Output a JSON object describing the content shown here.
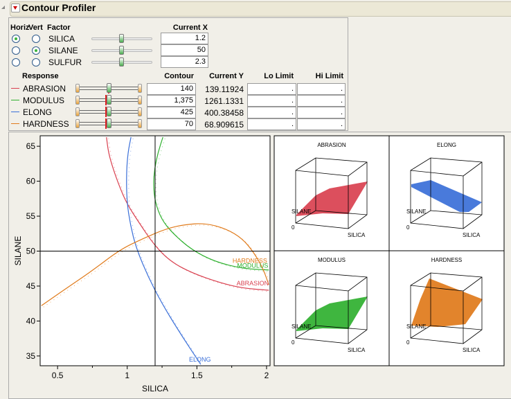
{
  "title": "Contour Profiler",
  "factors": {
    "headers": {
      "horiz": "Horiz",
      "vert": "Vert",
      "factor": "Factor",
      "current_x": "Current X"
    },
    "items": [
      {
        "name": "SILICA",
        "value": "1.2",
        "horiz": true,
        "vert": false,
        "slider": 0.5
      },
      {
        "name": "SILANE",
        "value": "50",
        "horiz": false,
        "vert": true,
        "slider": 0.5
      },
      {
        "name": "SULFUR",
        "value": "2.3",
        "horiz": false,
        "vert": false,
        "slider": 0.5
      }
    ]
  },
  "responses": {
    "headers": {
      "response": "Response",
      "contour": "Contour",
      "current_y": "Current Y",
      "lo": "Lo Limit",
      "hi": "Hi Limit"
    },
    "items": [
      {
        "name": "ABRASION",
        "color": "#d9404f",
        "contour": "140",
        "current_y": "139.11924",
        "lo": ".",
        "hi": "."
      },
      {
        "name": "MODULUS",
        "color": "#2fb02f",
        "contour": "1,375",
        "current_y": "1261.1331",
        "lo": ".",
        "hi": "."
      },
      {
        "name": "ELONG",
        "color": "#3a6fd8",
        "contour": "425",
        "current_y": "400.38458",
        "lo": ".",
        "hi": "."
      },
      {
        "name": "HARDNESS",
        "color": "#e07a1a",
        "contour": "70",
        "current_y": "68.909615",
        "lo": ".",
        "hi": "."
      }
    ]
  },
  "chart_data": {
    "type": "line",
    "xlabel": "SILICA",
    "ylabel": "SILANE",
    "xlim": [
      0.375,
      2.025
    ],
    "ylim": [
      33.6,
      66.5
    ],
    "xticks": [
      "0.5",
      "1",
      "1.5",
      "2"
    ],
    "yticks": [
      "35",
      "40",
      "45",
      "50",
      "55",
      "60",
      "65"
    ],
    "crosshair": {
      "x": 1.2,
      "y": 50
    },
    "series": [
      {
        "name": "ABRASION",
        "color": "#d9404f",
        "label_at": [
          1.9,
          45.1
        ],
        "x": [
          0.851,
          0.865,
          0.898,
          0.947,
          0.997,
          1.08,
          1.196,
          1.312,
          1.461,
          1.66,
          1.826,
          2.016
        ],
        "y": [
          66.3,
          64.1,
          61.8,
          59.1,
          56.8,
          54.2,
          50.8,
          48.5,
          46.9,
          45.5,
          44.7,
          44.4
        ]
      },
      {
        "name": "ELONG",
        "color": "#3a6fd8",
        "label_at": [
          1.6,
          34.2
        ],
        "x": [
          1.027,
          1.005,
          0.994,
          0.997,
          1.022,
          1.063,
          1.146,
          1.246,
          1.378,
          1.527
        ],
        "y": [
          66.3,
          64.1,
          61.1,
          57.1,
          53.8,
          50.5,
          46.5,
          42.6,
          38.3,
          33.8
        ]
      },
      {
        "name": "MODULUS",
        "color": "#2fb02f",
        "label_at": [
          1.9,
          47.6
        ],
        "x": [
          1.256,
          1.221,
          1.196,
          1.188,
          1.199,
          1.246,
          1.329,
          1.461,
          1.627,
          1.826,
          2.016
        ],
        "y": [
          66.3,
          64.1,
          61.8,
          59.5,
          57.1,
          54.5,
          52.5,
          50.2,
          48.5,
          47.5,
          47.3
        ]
      },
      {
        "name": "HARDNESS",
        "color": "#e07a1a",
        "label_at": [
          1.88,
          48.3
        ],
        "x": [
          0.384,
          0.55,
          0.749,
          0.947,
          1.113,
          1.279,
          1.412,
          1.561,
          1.71,
          1.826,
          1.909,
          1.975,
          2.016
        ],
        "y": [
          42.2,
          44.5,
          47.2,
          50.2,
          51.8,
          53.2,
          53.8,
          54.0,
          53.2,
          51.8,
          49.8,
          47.5,
          45.2
        ]
      }
    ]
  },
  "surfaces": [
    {
      "title": "ABRASION",
      "color": "#d9404f",
      "xlabel": "SILICA",
      "ylabel": "SILANE",
      "zero": "0"
    },
    {
      "title": "ELONG",
      "color": "#3a6fd8",
      "xlabel": "SILICA",
      "ylabel": "SILANE",
      "zero": "0"
    },
    {
      "title": "MODULUS",
      "color": "#2fb02f",
      "xlabel": "SILICA",
      "ylabel": "SILANE",
      "zero": "0"
    },
    {
      "title": "HARDNESS",
      "color": "#e07a1a",
      "xlabel": "SILICA",
      "ylabel": "SILANE",
      "zero": "0"
    }
  ]
}
